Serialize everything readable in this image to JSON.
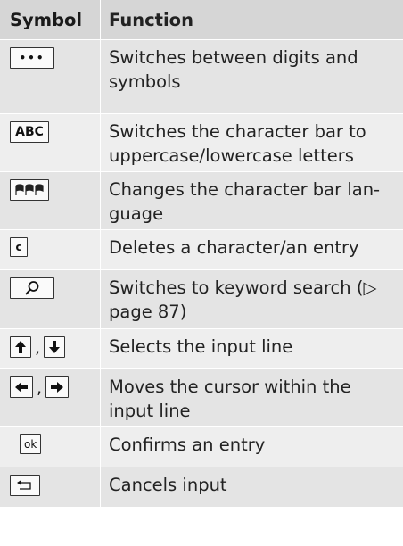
{
  "header": {
    "symbol": "Symbol",
    "function": "Function"
  },
  "rows": [
    {
      "keys": [
        "•••"
      ],
      "icons": [
        "dots-icon"
      ],
      "text": "Switches between digits and symbols"
    },
    {
      "keys": [
        "ABC"
      ],
      "icons": [
        "abc-icon"
      ],
      "text": "Switches the character bar to uppercase/lowercase letters"
    },
    {
      "keys": [
        ""
      ],
      "icons": [
        "flags-icon"
      ],
      "text": "Changes the character bar lan-guage"
    },
    {
      "keys": [
        "c"
      ],
      "icons": [
        "c-icon"
      ],
      "text": "Deletes a character/an entry"
    },
    {
      "keys": [
        ""
      ],
      "icons": [
        "search-icon"
      ],
      "text": "Switches to keyword search (▷ page 87)"
    },
    {
      "keys": [
        "",
        ""
      ],
      "icons": [
        "arrow-up-icon",
        "arrow-down-icon"
      ],
      "separator": ",",
      "text": "Selects the input line"
    },
    {
      "keys": [
        "",
        ""
      ],
      "icons": [
        "arrow-left-icon",
        "arrow-right-icon"
      ],
      "separator": ",",
      "text": "Moves the cursor within the input line"
    },
    {
      "keys": [
        "ok"
      ],
      "icons": [
        "ok-icon"
      ],
      "text": "Confirms an entry"
    },
    {
      "keys": [
        ""
      ],
      "icons": [
        "back-icon"
      ],
      "text": "Cancels input"
    }
  ]
}
